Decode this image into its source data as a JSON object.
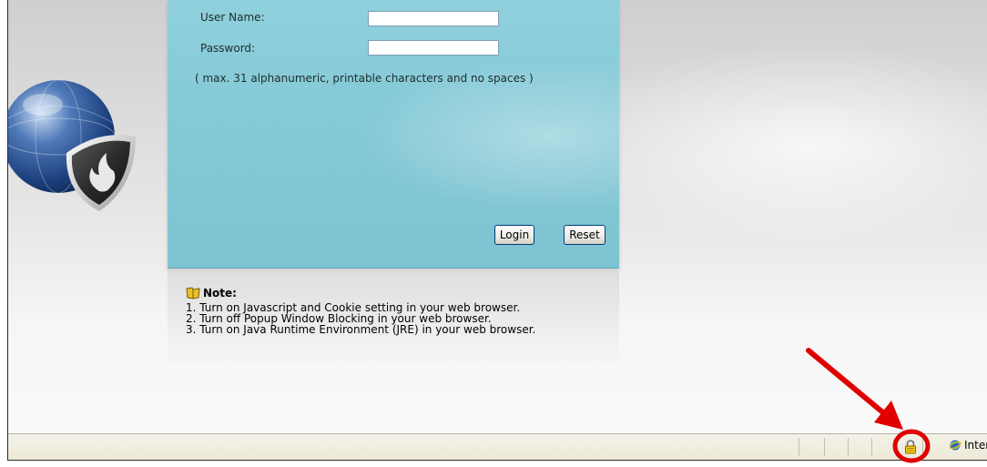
{
  "login": {
    "username_label": "User Name:",
    "username_value": "",
    "password_label": "Password:",
    "password_value": "",
    "hint": "( max. 31 alphanumeric, printable characters and no spaces )",
    "login_button": "Login",
    "reset_button": "Reset"
  },
  "note": {
    "title": "Note:",
    "items": [
      "1. Turn on Javascript and Cookie setting in your web browser.",
      "2. Turn off Popup Window Blocking in your web browser.",
      "3. Turn on Java Runtime Environment (JRE) in your web browser."
    ]
  },
  "statusbar": {
    "zone_label": "Interne",
    "icons": [
      "lock-icon",
      "internet-zone-icon"
    ]
  },
  "colors": {
    "panel": "#86cad7",
    "annotation": "#e00000"
  },
  "icons": [
    "globe-icon",
    "shield-icon",
    "note-icon",
    "annotation-arrow",
    "annotation-circle"
  ]
}
